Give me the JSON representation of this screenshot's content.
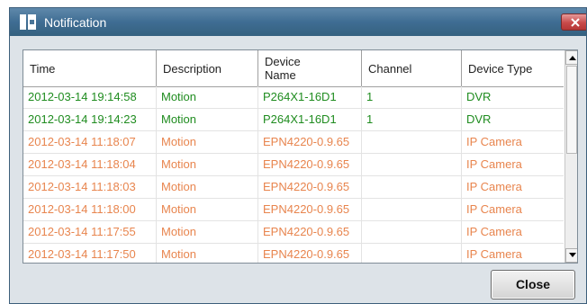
{
  "window": {
    "title": "Notification"
  },
  "colors": {
    "dvr_text": "#1f8c1f",
    "ip_camera_text": "#e8854e"
  },
  "table": {
    "headers": [
      "Time",
      "Description",
      "Device Name",
      "Channel",
      "Device Type"
    ],
    "rows": [
      {
        "time": "2012-03-14 19:14:58",
        "description": "Motion",
        "device_name": "P264X1-16D1",
        "channel": "1",
        "device_type": "DVR"
      },
      {
        "time": "2012-03-14 19:14:23",
        "description": "Motion",
        "device_name": "P264X1-16D1",
        "channel": "1",
        "device_type": "DVR"
      },
      {
        "time": "2012-03-14 11:18:07",
        "description": "Motion",
        "device_name": "EPN4220-0.9.65",
        "channel": "",
        "device_type": "IP Camera"
      },
      {
        "time": "2012-03-14 11:18:04",
        "description": "Motion",
        "device_name": "EPN4220-0.9.65",
        "channel": "",
        "device_type": "IP Camera"
      },
      {
        "time": "2012-03-14 11:18:03",
        "description": "Motion",
        "device_name": "EPN4220-0.9.65",
        "channel": "",
        "device_type": "IP Camera"
      },
      {
        "time": "2012-03-14 11:18:00",
        "description": "Motion",
        "device_name": "EPN4220-0.9.65",
        "channel": "",
        "device_type": "IP Camera"
      },
      {
        "time": "2012-03-14 11:17:55",
        "description": "Motion",
        "device_name": "EPN4220-0.9.65",
        "channel": "",
        "device_type": "IP Camera"
      },
      {
        "time": "2012-03-14 11:17:50",
        "description": "Motion",
        "device_name": "EPN4220-0.9.65",
        "channel": "",
        "device_type": "IP Camera"
      }
    ]
  },
  "buttons": {
    "close_label": "Close"
  },
  "icons": {
    "app": "notification-app-icon",
    "window_close": "close-icon",
    "scroll_up": "arrow-up-icon",
    "scroll_down": "arrow-down-icon"
  }
}
